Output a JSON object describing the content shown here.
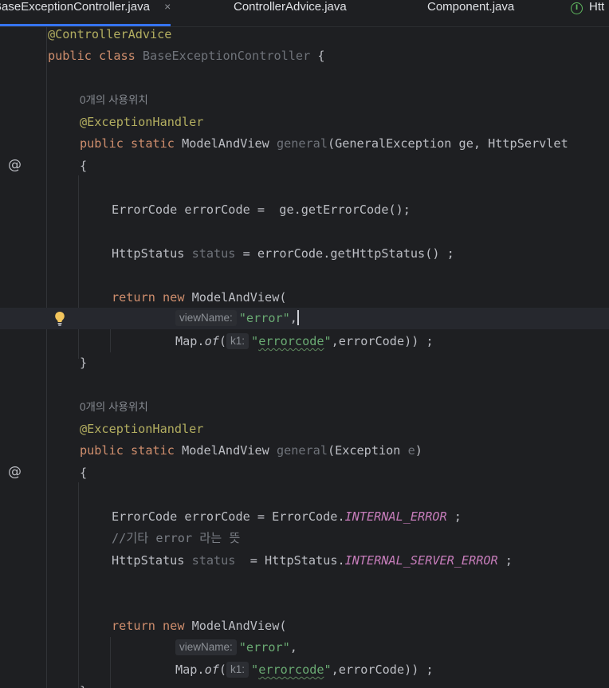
{
  "tabs": [
    {
      "label": "BaseExceptionController.java",
      "close": "×",
      "active": true
    },
    {
      "label": "ControllerAdvice.java",
      "active": false
    },
    {
      "label": "Component.java",
      "active": false
    },
    {
      "label": "Htt",
      "badge": "I",
      "active": false
    }
  ],
  "code": {
    "l1_ann": "@ControllerAdvice",
    "l2_public": "public",
    "l2_class": "class",
    "l2_name": "BaseExceptionController",
    "l2_brace": " {",
    "usage1": "0개의 사용위치",
    "handler1": "@ExceptionHandler",
    "m1_public": "public",
    "m1_static": "static",
    "m1_type": "ModelAndView",
    "m1_name": "general",
    "m1_params": "(GeneralException ge, HttpServlet",
    "m1_open": "{",
    "m1_l1": "ErrorCode errorCode =  ge.getErrorCode();",
    "m1_l2a": "HttpStatus ",
    "m1_l2b": "status",
    "m1_l2c": " = errorCode.getHttpStatus() ;",
    "m1_ret": "return",
    "m1_new": "new",
    "m1_mav": " ModelAndView(",
    "hint_viewname": "viewName:",
    "str_error": "\"error\"",
    "comma": ",",
    "map": "Map.",
    "of": "of",
    "paren": "(",
    "hint_k1": "k1:",
    "str_q": "\"",
    "str_errorcode": "errorcode",
    "map_tail": ",errorCode)) ;",
    "m1_close": "}",
    "usage2": "0개의 사용위치",
    "handler2": "@ExceptionHandler",
    "m2_public": "public",
    "m2_static": "static",
    "m2_type": "ModelAndView",
    "m2_name": "general",
    "m2_p1": "(Exception ",
    "m2_p2": "e",
    "m2_p3": ")",
    "m2_open": "{",
    "m2_l1a": "ErrorCode errorCode = ErrorCode.",
    "m2_l1b": "INTERNAL_ERROR",
    "m2_l1c": " ;",
    "m2_cmt": "//기타 error 라는 뜻",
    "m2_l2a": "HttpStatus ",
    "m2_l2b": "status",
    "m2_l2c": "  = HttpStatus.",
    "m2_l2d": "INTERNAL_SERVER_ERROR",
    "m2_l2e": " ;",
    "m2_ret": "return",
    "m2_new": "new",
    "m2_mav": " ModelAndView(",
    "m2_close": "}"
  },
  "gutter": {
    "at_icon": "@"
  },
  "colors": {
    "background": "#1e1f22",
    "keyword": "#cf8e6d",
    "annotation": "#b3ae60",
    "string": "#6aab73",
    "constant": "#c77dbb",
    "active_tab_underline": "#3574f0"
  }
}
